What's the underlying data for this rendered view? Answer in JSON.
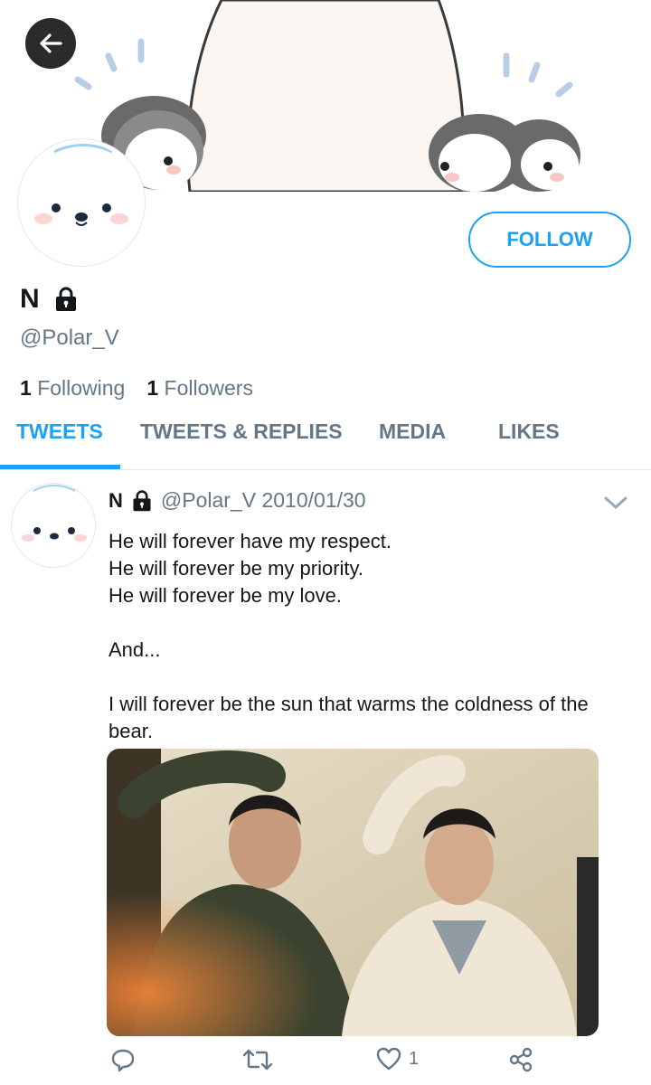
{
  "profile": {
    "display_name": "N",
    "handle": "@Polar_V",
    "following_count": "1",
    "following_label": "Following",
    "followers_count": "1",
    "followers_label": "Followers",
    "follow_label": "FOLLOW"
  },
  "tabs": [
    {
      "label": "TWEETS",
      "active": true
    },
    {
      "label": "TWEETS & REPLIES",
      "active": false
    },
    {
      "label": "MEDIA",
      "active": false
    },
    {
      "label": "LIKES",
      "active": false
    }
  ],
  "tweet": {
    "name": "N",
    "meta": "@Polar_V 2010/01/30",
    "lines": [
      "He will forever have my respect.",
      "He will forever be my priority.",
      "He will forever be my love.",
      "",
      "And...",
      "",
      "I will forever be the sun that warms the coldness of the bear."
    ],
    "like_count": "1"
  },
  "icons": {
    "back": "back-arrow-icon",
    "lock": "lock-icon",
    "caret": "chevron-down-icon",
    "reply": "reply-icon",
    "retweet": "retweet-icon",
    "like": "heart-icon",
    "share": "share-icon"
  },
  "colors": {
    "accent": "#1da1f2",
    "muted": "#657786",
    "text": "#14171a"
  }
}
